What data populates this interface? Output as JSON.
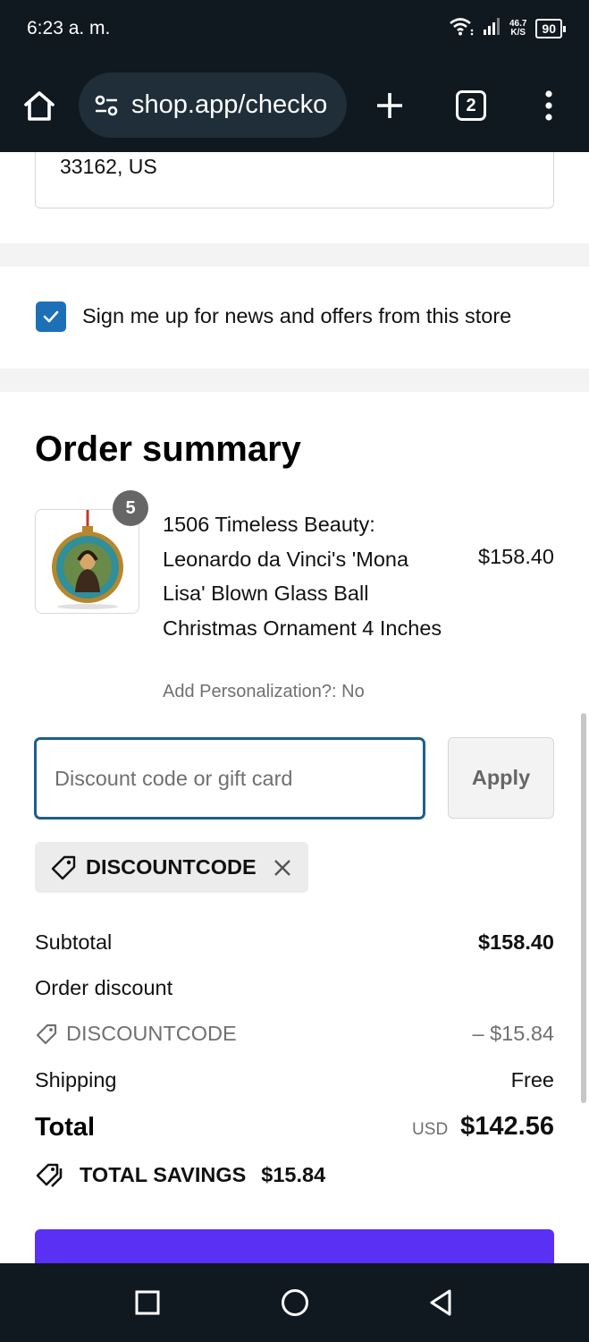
{
  "status_bar": {
    "time": "6:23 a. m.",
    "speed_value": "46.7",
    "speed_unit": "K/S",
    "battery": "90"
  },
  "browser": {
    "url": "shop.app/checko",
    "tab_count": "2"
  },
  "checkout": {
    "address_tail": "33162, US",
    "newsletter_label": "Sign me up for news and offers from this store",
    "newsletter_checked": true
  },
  "order_summary": {
    "title": "Order summary",
    "item": {
      "quantity": "5",
      "title": "1506 Timeless Beauty: Leonardo da Vinci's 'Mona Lisa' Blown Glass Ball Christmas Ornament 4 Inches",
      "price": "$158.40",
      "option": "Add Personalization?: No"
    },
    "discount": {
      "placeholder": "Discount code or gift card",
      "apply_label": "Apply",
      "applied_code": "DISCOUNTCODE"
    },
    "totals": {
      "subtotal_label": "Subtotal",
      "subtotal_value": "$158.40",
      "order_discount_label": "Order discount",
      "discount_code": "DISCOUNTCODE",
      "discount_value": "– $15.84",
      "shipping_label": "Shipping",
      "shipping_value": "Free",
      "total_label": "Total",
      "currency": "USD",
      "total_value": "$142.56",
      "savings_label": "TOTAL SAVINGS",
      "savings_value": "$15.84"
    }
  },
  "colors": {
    "checkbox": "#1d6fb8",
    "focus_border": "#1d5f8c",
    "pay_button": "#5a31f4",
    "system_bar": "#101820"
  },
  "icons": {
    "home": "home-icon",
    "site_settings": "tune-icon",
    "new_tab": "plus-icon",
    "menu": "more-vert-icon",
    "tag": "tag-icon",
    "remove": "close-icon",
    "savings": "tags-icon",
    "nav_recents": "square-icon",
    "nav_home": "circle-icon",
    "nav_back": "triangle-back-icon"
  }
}
